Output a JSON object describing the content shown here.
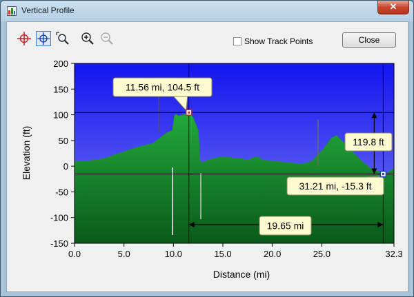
{
  "window": {
    "title": "Vertical Profile",
    "close_glyph": "✕"
  },
  "toolbar": {
    "tools": [
      {
        "icon": "crosshair-red-icon",
        "color": "#d42020"
      },
      {
        "icon": "crosshair-blue-icon",
        "color": "#1a3fc0",
        "selected": true
      },
      {
        "icon": "zoom-drag-icon"
      },
      {
        "icon": "zoom-in-icon"
      },
      {
        "icon": "zoom-out-icon",
        "disabled": true
      }
    ],
    "show_track_points": {
      "label": "Show Track Points",
      "checked": false
    },
    "close_label": "Close"
  },
  "chart_data": {
    "type": "area",
    "xlabel": "Distance (mi)",
    "ylabel": "Elevation (ft)",
    "xlim": [
      0,
      32.3
    ],
    "ylim": [
      -150,
      200
    ],
    "x_ticks": [
      "0.0",
      "5.0",
      "10.0",
      "15.0",
      "20.0",
      "25.0",
      "32.3"
    ],
    "x_tick_values": [
      0,
      5,
      10,
      15,
      20,
      25,
      32.3
    ],
    "y_ticks": [
      "200",
      "150",
      "100",
      "50",
      "0",
      "-50",
      "-100",
      "-150"
    ],
    "y_tick_values": [
      200,
      150,
      100,
      50,
      0,
      -50,
      -100,
      -150
    ],
    "fill_colors": {
      "sky_top": "#1414f0",
      "sky_bottom": "#7a7cf2",
      "terrain_top": "#23aa3c",
      "terrain_bottom": "#0a5a1a"
    },
    "x": [
      0,
      1,
      2,
      3,
      4,
      5,
      6,
      7,
      8,
      8.7,
      9.3,
      9.9,
      10.1,
      10.2,
      10.3,
      10.5,
      11,
      11.56,
      12,
      12.3,
      12.5,
      12.7,
      12.8,
      13,
      13.5,
      14,
      15,
      16,
      17,
      17.5,
      18,
      18.5,
      19,
      20,
      21,
      22,
      23,
      24,
      25,
      26,
      26.5,
      27,
      28,
      29,
      30,
      31,
      31.21,
      31.6,
      32,
      32.3
    ],
    "y": [
      10,
      9,
      12,
      15,
      22,
      28,
      35,
      40,
      45,
      56,
      65,
      70,
      98,
      100,
      101,
      98,
      100,
      104.5,
      95,
      80,
      70,
      10,
      5,
      8,
      12,
      15,
      18,
      16,
      14,
      12,
      16,
      18,
      12,
      10,
      8,
      6,
      4,
      10,
      30,
      55,
      60,
      50,
      30,
      10,
      -5,
      -12,
      -15.3,
      -14,
      -8,
      -5
    ],
    "markers": [
      {
        "x": 11.56,
        "y": 104.5,
        "label": "11.56 mi, 104.5 ft",
        "color": "#d42020"
      },
      {
        "x": 31.21,
        "y": -15.3,
        "label": "31.21 mi, -15.3 ft",
        "color": "#1a3fc0"
      }
    ],
    "delta_elevation_label": "119.8 ft",
    "delta_distance_label": "19.65 mi"
  }
}
